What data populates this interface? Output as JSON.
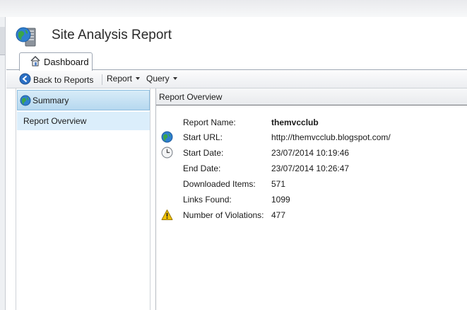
{
  "app": {
    "title": "Site Analysis Report"
  },
  "tabs": [
    {
      "label": "Dashboard",
      "icon": "home-icon"
    }
  ],
  "toolbar": {
    "back_label": "Back to Reports",
    "report_label": "Report",
    "query_label": "Query"
  },
  "sidebar": {
    "items": [
      {
        "label": "Summary",
        "icon": "globe-icon",
        "selected": true
      },
      {
        "label": "Report Overview",
        "selected": false
      }
    ]
  },
  "content": {
    "header": "Report Overview",
    "rows": [
      {
        "label": "Report Name:",
        "value": "themvcclub",
        "icon": ""
      },
      {
        "label": "Start URL:",
        "value": "http://themvcclub.blogspot.com/",
        "icon": "globe-icon"
      },
      {
        "label": "Start Date:",
        "value": "23/07/2014 10:19:46",
        "icon": "clock-icon"
      },
      {
        "label": "End Date:",
        "value": "23/07/2014 10:26:47",
        "icon": ""
      },
      {
        "label": "Downloaded Items:",
        "value": "571",
        "icon": ""
      },
      {
        "label": "Links Found:",
        "value": "1099",
        "icon": ""
      },
      {
        "label": "Number of Violations:",
        "value": "477",
        "icon": "warning-icon"
      }
    ]
  },
  "colors": {
    "accent_selected": "#b6d8ef",
    "sidebar_item_bg": "#dbeefb",
    "warning": "#f3c300"
  }
}
